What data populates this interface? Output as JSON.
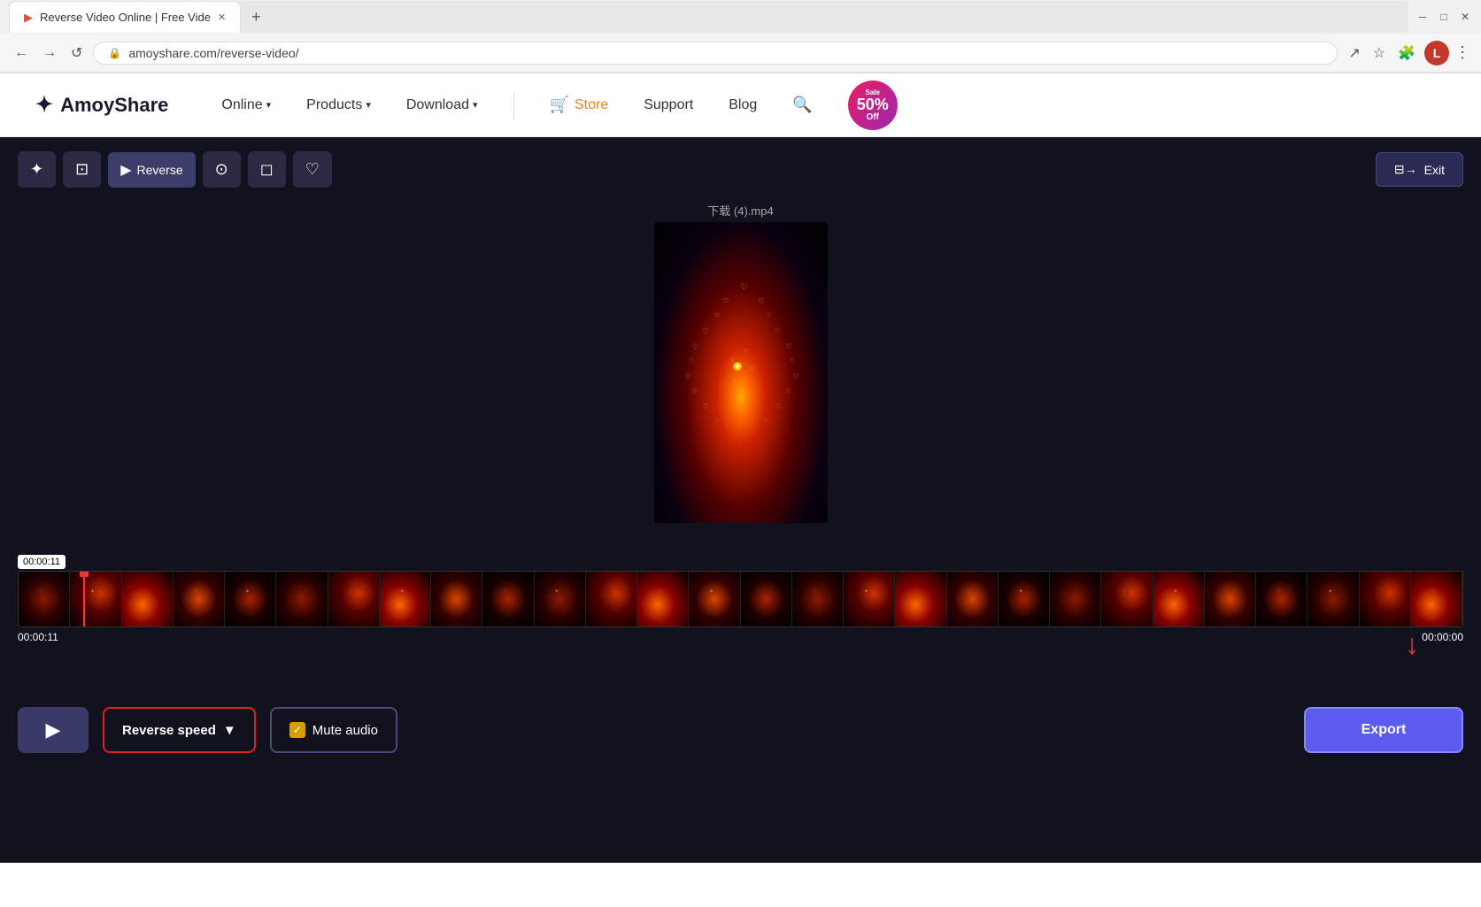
{
  "browser": {
    "tab_title": "Reverse Video Online | Free Vide",
    "tab_favicon": "▶",
    "new_tab_label": "+",
    "nav": {
      "back": "←",
      "forward": "→",
      "refresh": "↺",
      "url": "amoyshare.com/reverse-video/",
      "share_icon": "↗",
      "star_icon": "☆",
      "extension_icon": "🧩",
      "profile_letter": "L",
      "menu_icon": "⋮"
    }
  },
  "header": {
    "logo_text": "AmoyShare",
    "logo_icon": "✦",
    "nav_items": [
      {
        "id": "online",
        "label": "Online",
        "has_chevron": true
      },
      {
        "id": "products",
        "label": "Products",
        "has_chevron": true
      },
      {
        "id": "download",
        "label": "Download",
        "has_chevron": true
      }
    ],
    "store_label": "Store",
    "store_icon": "🛒",
    "support_label": "Support",
    "blog_label": "Blog",
    "sale_percent": "50%",
    "sale_off": "Off"
  },
  "editor": {
    "toolbar": {
      "buttons": [
        {
          "id": "magic",
          "icon": "✦",
          "label": ""
        },
        {
          "id": "crop",
          "icon": "⊡",
          "label": ""
        },
        {
          "id": "reverse",
          "icon": "▶",
          "label": "Reverse",
          "active": true
        },
        {
          "id": "screenshot",
          "icon": "⊙",
          "label": ""
        },
        {
          "id": "camera",
          "icon": "◻",
          "label": ""
        },
        {
          "id": "heart",
          "icon": "♡",
          "label": ""
        }
      ],
      "exit_icon": "⊡→",
      "exit_label": "Exit"
    },
    "video": {
      "filename": "下载 (4).mp4"
    },
    "timeline": {
      "start_time": "00:00:11",
      "end_time": "00:00:00",
      "current_time": "00:00:11"
    },
    "controls": {
      "play_icon": "▶",
      "reverse_speed_label": "Reverse speed",
      "reverse_speed_chevron": "▼",
      "mute_audio_label": "Mute audio",
      "mute_checked": true,
      "export_label": "Export"
    }
  }
}
